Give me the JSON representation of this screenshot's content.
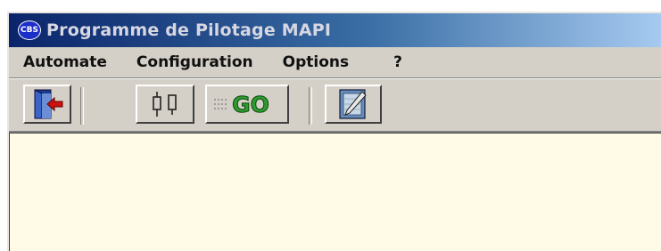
{
  "window": {
    "title": "Programme de Pilotage MAPI",
    "icon_label": "CBS"
  },
  "menu": [
    {
      "label": "Automate"
    },
    {
      "label": "Configuration"
    },
    {
      "label": "Options"
    },
    {
      "label": "?"
    }
  ],
  "toolbar": {
    "buttons": [
      {
        "name": "exit",
        "icon": "exit-door-icon"
      },
      {
        "name": "connect",
        "icon": "connector-icon"
      },
      {
        "name": "go",
        "icon": "go-icon",
        "label": "GO"
      },
      {
        "name": "edit",
        "icon": "edit-pencil-icon"
      }
    ]
  },
  "colors": {
    "title_gradient_start": "#0a246a",
    "title_gradient_end": "#a6caf0",
    "client_background": "#fffbe6",
    "go_green": "#2f9a2f",
    "exit_arrow": "#cc1111"
  }
}
